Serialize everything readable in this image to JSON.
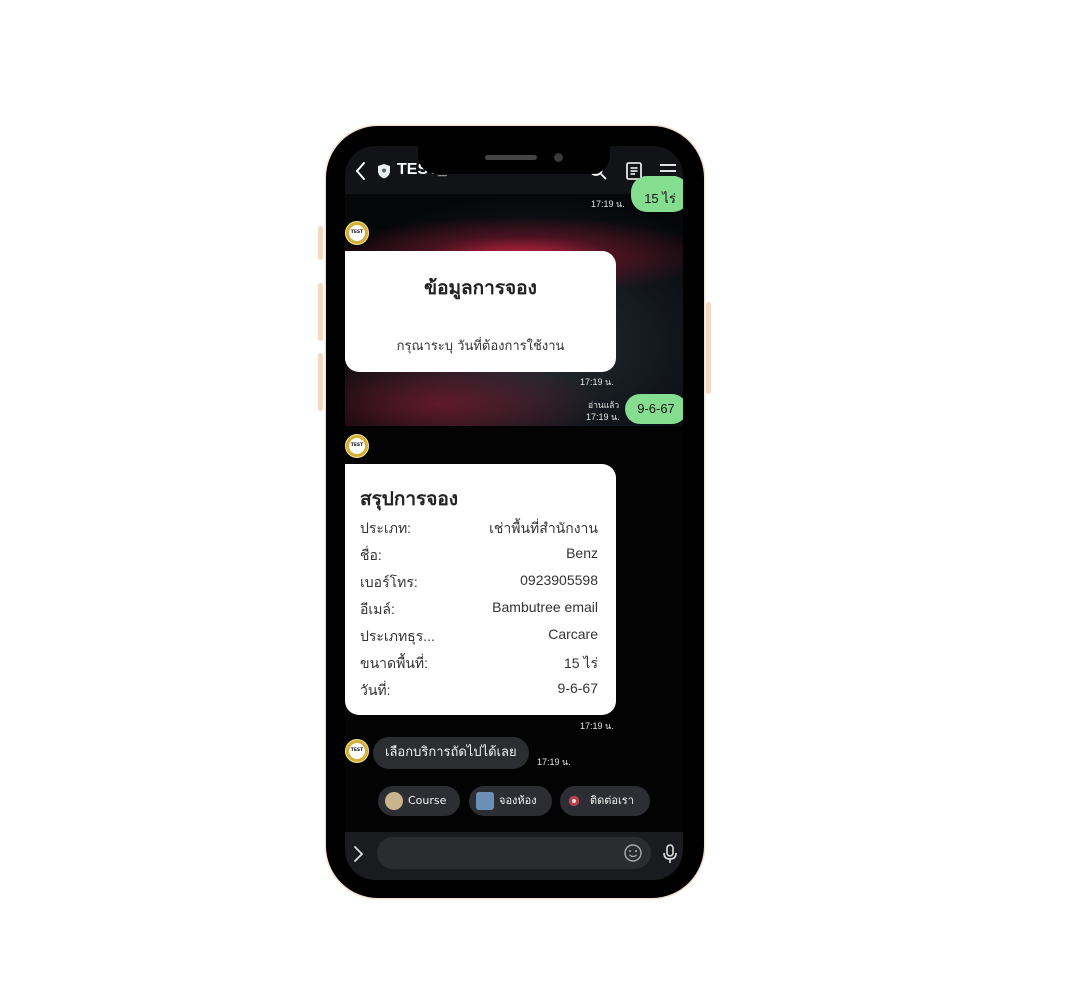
{
  "header": {
    "title": "TEST_BOT",
    "icons": [
      "back-chevron-icon",
      "shield-icon",
      "search-icon",
      "notes-icon",
      "menu-icon"
    ]
  },
  "messages": {
    "prev_reply": {
      "text": "15 ไร่",
      "time": "17:19 น."
    },
    "card_booking_info": {
      "title": "ข้อมูลการจอง",
      "subtitle": "กรุณาระบุ วันที่ต้องการใช้งาน",
      "time": "17:19 น."
    },
    "user_date": {
      "text": "9-6-67",
      "read": "อ่านแล้ว",
      "time": "17:19 น."
    },
    "card_summary": {
      "title": "สรุปการจอง",
      "rows": [
        {
          "label": "ประเภท:",
          "value": "เช่าพื้นที่สำนักงาน"
        },
        {
          "label": "ชื่อ:",
          "value": "Benz"
        },
        {
          "label": "เบอร์โทร:",
          "value": "0923905598"
        },
        {
          "label": "อีเมล์:",
          "value": "Bambutree email"
        },
        {
          "label": "ประเภทธุร...",
          "value": "Carcare"
        },
        {
          "label": "ขนาดพื้นที่:",
          "value": "15 ไร่"
        },
        {
          "label": "วันที่:",
          "value": "9-6-67"
        }
      ],
      "time": "17:19 น."
    },
    "bot_prompt": {
      "text": "เลือกบริการถัดไปได้เลย",
      "time": "17:19 น."
    },
    "avatar_label": "TEST"
  },
  "quick_replies": [
    {
      "label": "Course",
      "icon": "course-icon"
    },
    {
      "label": "จองห้อง",
      "icon": "room-icon"
    },
    {
      "label": "ติดต่อเรา",
      "icon": "contact-icon"
    }
  ],
  "composer": {
    "placeholder": "",
    "icons": [
      "expand-chevron-icon",
      "emoji-icon",
      "microphone-icon"
    ]
  },
  "colors": {
    "sent_bubble": "#85de8f",
    "card_bg": "#ffffff",
    "chat_bg": "#0b0c10",
    "phone_trim": "#f3d9c3"
  }
}
